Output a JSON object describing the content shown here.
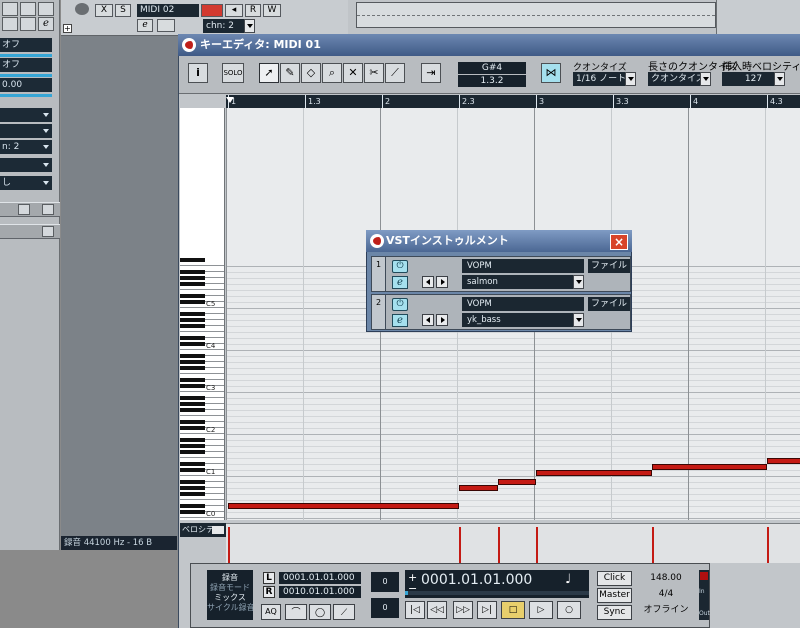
{
  "colors": {
    "note": "#c41a14",
    "display_bg": "#1b2731",
    "titlebar": "#4f6a97",
    "accent": "#36a6d6"
  },
  "inspector": {
    "fields": [
      "オフ",
      "オフ",
      "",
      "0.00",
      "",
      "",
      "n: 2",
      "し"
    ],
    "icons": [
      "lock-icon",
      "edit-icon"
    ]
  },
  "track": {
    "mute": "M",
    "solo": "S",
    "x": "X",
    "name": "MIDI 02",
    "rec": "R",
    "write": "W",
    "edit_glyph": "e",
    "channel": "chn: 2"
  },
  "status": {
    "text": "録音 44100 Hz - 16 B"
  },
  "editor": {
    "title": "キーエディタ: MIDI 01",
    "info_label": "i",
    "solo_label": "SOLO",
    "note_pitch": "G#4",
    "note_pos": "1.3.2",
    "quantize_label": "クオンタイズ",
    "quantize_value": "1/16 ノート",
    "length_label": "長さのクオンタイズ",
    "length_value": "クオンタイズに",
    "velocity_label": "挿入時ベロシティ",
    "velocity_value": "127",
    "ruler": [
      "1",
      "1.3",
      "2",
      "2.3",
      "3",
      "3.3",
      "4",
      "4.3"
    ],
    "octaves": [
      "C5",
      "C4",
      "C3",
      "C2",
      "C1",
      "C0"
    ],
    "ctrl_label": "ベロシティ"
  },
  "notes": [
    {
      "start": 1.0,
      "end": 2.5,
      "pitch": "D#0"
    },
    {
      "start": 2.5,
      "end": 2.75,
      "pitch": "G#0"
    },
    {
      "start": 2.75,
      "end": 3.0,
      "pitch": "A#0"
    },
    {
      "start": 3.0,
      "end": 3.75,
      "pitch": "C1"
    },
    {
      "start": 3.75,
      "end": 4.5,
      "pitch": "D1"
    },
    {
      "start": 4.5,
      "end": 4.75,
      "pitch": "E1"
    }
  ],
  "vst": {
    "title": "VSTインストゥルメント",
    "close": "×",
    "slots": [
      {
        "num": "1",
        "plugin": "VOPM",
        "program": "salmon",
        "file": "ファイル"
      },
      {
        "num": "2",
        "plugin": "VOPM",
        "program": "yk_bass",
        "file": "ファイル"
      }
    ]
  },
  "transport": {
    "mode1": "録音",
    "mode2": "録音モード",
    "mode3": "ミックス",
    "mode4": "サイクル録音",
    "L": "L",
    "R": "R",
    "left_locator": "0001.01.01.000",
    "right_locator": "0010.01.01.000",
    "aq": "AQ",
    "pre": "0",
    "post": "0",
    "position": "0001.01.01.000",
    "click": "Click",
    "master": "Master",
    "sync": "Sync",
    "tempo": "148.00",
    "signature": "4/4",
    "offline": "オフライン",
    "in": "In",
    "out": "Out",
    "plus": "+",
    "minus": "−"
  }
}
